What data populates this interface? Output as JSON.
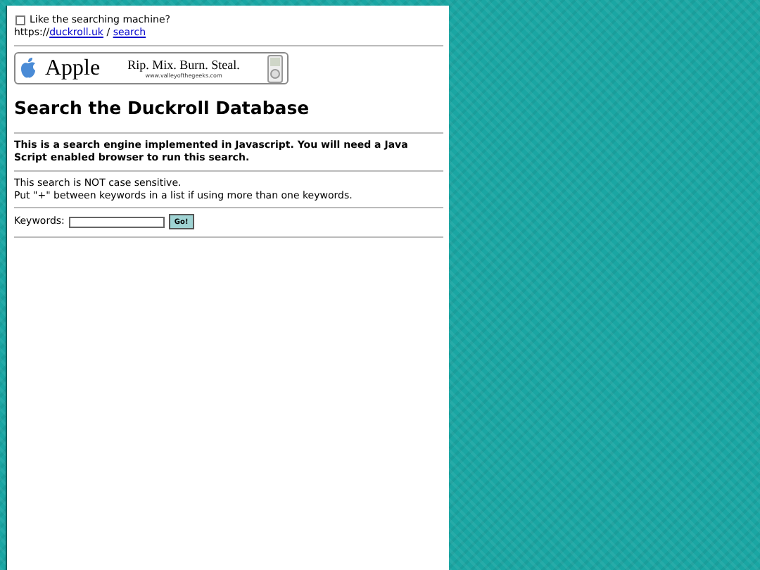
{
  "top_bar": {
    "checkbox": {
      "label": "Like the searching machine?",
      "checked": false
    },
    "breadcrumb": [
      {
        "kind": "text",
        "text": "https://"
      },
      {
        "kind": "link",
        "text": "duckroll.uk"
      },
      {
        "kind": "text",
        "text": " / "
      },
      {
        "kind": "link",
        "text": "search"
      }
    ]
  },
  "banner": {
    "brand": "Apple",
    "slogan": "Rip. Mix. Burn. Steal.",
    "url": "www.valleyofthegeeks.com"
  },
  "heading": "Search the Duckroll Database",
  "intro": "This is a search engine implemented in Javascript. You will need a Java Script enabled browser to run this search.",
  "notes": [
    "This search is NOT case sensitive.",
    "Put \"+\" between keywords in a list if using more than one keywords."
  ],
  "search": {
    "label": "Keywords:",
    "button": "Go!"
  }
}
